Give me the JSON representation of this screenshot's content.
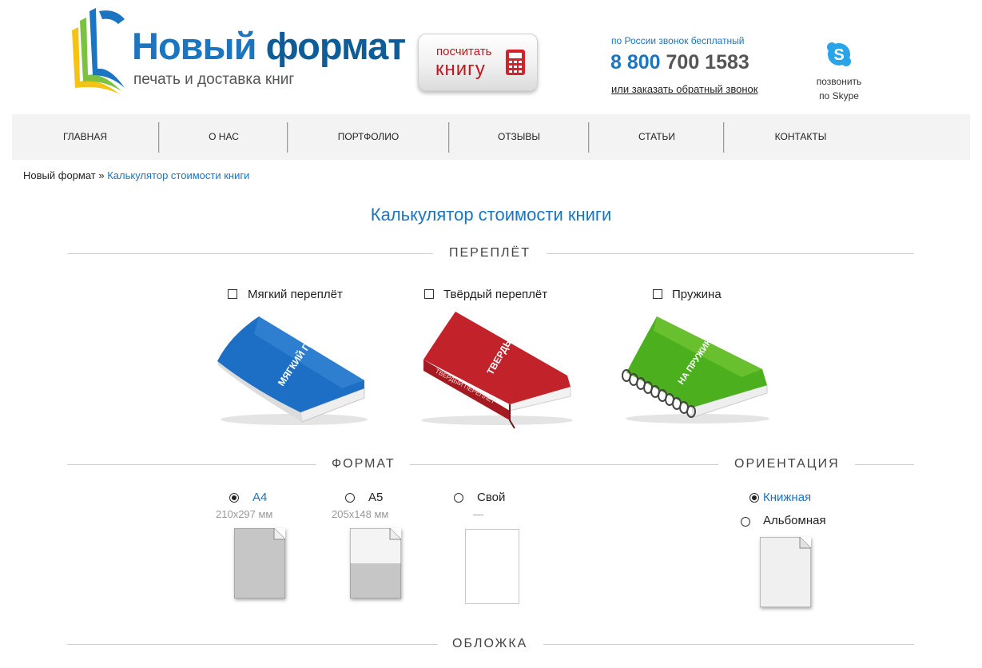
{
  "header": {
    "logo_name_part1": "Новый",
    "logo_name_part2": "формат",
    "logo_tagline": "печать и доставка книг",
    "calc_button": {
      "line1": "посчитать",
      "line2": "книгу"
    },
    "phone_note": "по России звонок бесплатный",
    "phone_prefix": "8 800",
    "phone_number": "700 1583",
    "callback_link": "или заказать обратный звонок",
    "skype": {
      "line1": "позвонить",
      "line2": "по Skype"
    }
  },
  "nav": [
    "ГЛАВНАЯ",
    "О НАС",
    "ПОРТФОЛИО",
    "ОТЗЫВЫ",
    "СТАТЬИ",
    "КОНТАКТЫ"
  ],
  "breadcrumb": {
    "home": "Новый формат",
    "separator": "»",
    "current": "Калькулятор стоимости книги"
  },
  "page_title": "Калькулятор стоимости книги",
  "binding": {
    "title": "ПЕРЕПЛЁТ",
    "options": [
      {
        "label": "Мягкий переплёт",
        "checked": false,
        "cover_text": "МЯГКИЙ ПЕРЕПЛЕТ",
        "color": "#1c6fc4"
      },
      {
        "label": "Твёрдый переплёт",
        "checked": false,
        "cover_text": "ТВЕРДЫЙ ПЕРЕПЛЕТ",
        "spine_text": "ТВЕРДЫЙ ПЕРЕПЛЕТ",
        "color": "#c2232b"
      },
      {
        "label": "Пружина",
        "checked": false,
        "cover_text": "НА ПРУЖИНУ",
        "color": "#4caf1e"
      }
    ]
  },
  "format": {
    "title": "ФОРМАТ",
    "options": [
      {
        "label": "А4",
        "size": "210x297 мм",
        "selected": true
      },
      {
        "label": "А5",
        "size": "205x148 мм",
        "selected": false
      },
      {
        "label": "Свой",
        "size": "—",
        "selected": false
      }
    ]
  },
  "orientation": {
    "title": "ОРИЕНТАЦИЯ",
    "options": [
      {
        "label": "Книжная",
        "selected": true
      },
      {
        "label": "Альбомная",
        "selected": false
      }
    ]
  },
  "cover": {
    "title": "ОБЛОЖКА"
  },
  "colors": {
    "accent": "#1b75c0",
    "red": "#c0161c",
    "nav_bg": "#f3f3f3"
  }
}
